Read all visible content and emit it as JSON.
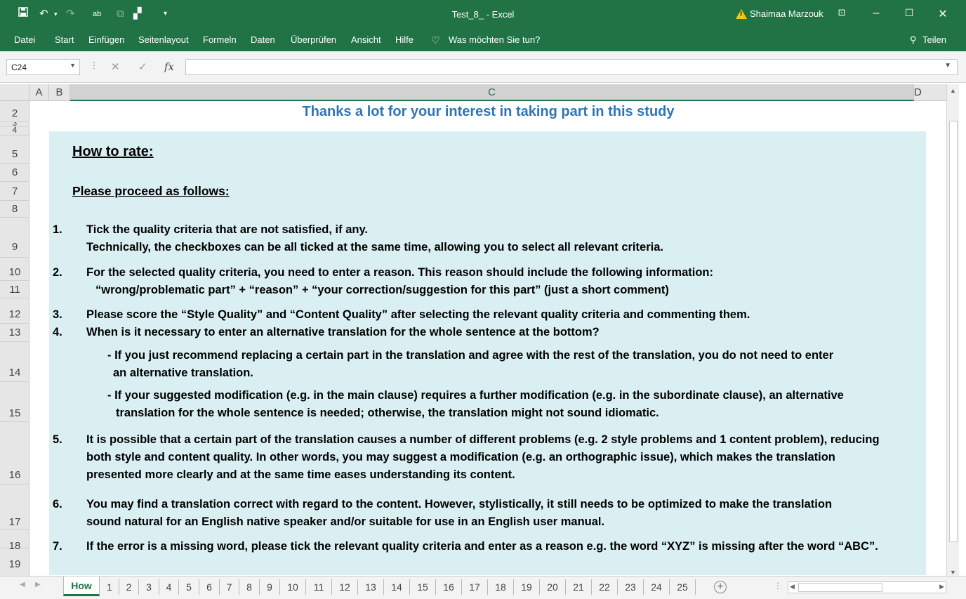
{
  "window": {
    "title": "Test_8_  -  Excel",
    "user": "Shaimaa Marzouk"
  },
  "menu": [
    "Datei",
    "Start",
    "Einfügen",
    "Seitenlayout",
    "Formeln",
    "Daten",
    "Überprüfen",
    "Ansicht",
    "Hilfe"
  ],
  "tell_me": "Was möchten Sie tun?",
  "share": "Teilen",
  "formula_bar": {
    "name_box": "C24",
    "fx": "fx",
    "value": ""
  },
  "columns": [
    "A",
    "B",
    "C",
    "D"
  ],
  "rows": [
    "2",
    "3",
    "4",
    "5",
    "6",
    "7",
    "8",
    "9",
    "10",
    "11",
    "12",
    "13",
    "14",
    "15",
    "16",
    "17",
    "18",
    "19"
  ],
  "content": {
    "banner": "Thanks a lot for your interest in taking part in this study",
    "how_to_rate": "How to rate:",
    "proceed": "Please proceed as follows:",
    "item1_num": "1.",
    "item1_a": "Tick the quality criteria that are not satisfied, if any.",
    "item1_b": "Technically, the checkboxes can be all ticked at the same time, allowing you to select all relevant criteria.",
    "item2_num": "2.",
    "item2_a": "For the selected quality criteria, you need to enter a reason. This reason should include the following information:",
    "item2_b": "“wrong/problematic part” + “reason” + “your correction/suggestion for this part” (just a short comment)",
    "item3_num": "3.",
    "item3": "Please score the “Style Quality” and “Content Quality” after selecting the relevant quality criteria and commenting them.",
    "item4_num": "4.",
    "item4": "When is it necessary to enter an alternative translation for the whole sentence at the bottom?",
    "item4_sub1_a": "- If you just recommend replacing a certain part in the translation and agree with the rest of the translation, you do not need to enter",
    "item4_sub1_b": "an alternative translation.",
    "item4_sub2_a": "- If your suggested modification (e.g. in the main clause) requires a further modification (e.g. in the subordinate clause), an alternative",
    "item4_sub2_b": "translation for the whole sentence is needed; otherwise, the translation might not sound idiomatic.",
    "item5_num": "5.",
    "item5_a": "It is possible that a certain part of the translation causes a number of different problems (e.g. 2 style problems and 1 content problem), reducing",
    "item5_b": "both style and content quality. In other words, you may suggest a modification (e.g. an orthographic issue), which makes the translation",
    "item5_c": "presented more clearly and at the same time eases understanding its content.",
    "item6_num": "6.",
    "item6_a": "You may find a translation correct with regard to the content. However, stylistically, it still needs to be optimized to make the translation",
    "item6_b": "sound natural for an English native speaker and/or suitable for use in an English user manual.",
    "item7_num": "7.",
    "item7": "If the error is a missing word, please tick the relevant quality criteria and enter as a reason e.g. the word “XYZ” is missing after the word “ABC”."
  },
  "sheet_tabs": [
    "How",
    "1",
    "2",
    "3",
    "4",
    "5",
    "6",
    "7",
    "8",
    "9",
    "10",
    "11",
    "12",
    "13",
    "14",
    "15",
    "16",
    "17",
    "18",
    "19",
    "20",
    "21",
    "22",
    "23",
    "24",
    "25"
  ],
  "colors": {
    "excel_green": "#217346",
    "banner_blue": "#2e75b6",
    "box_bg": "#d9eff1"
  }
}
